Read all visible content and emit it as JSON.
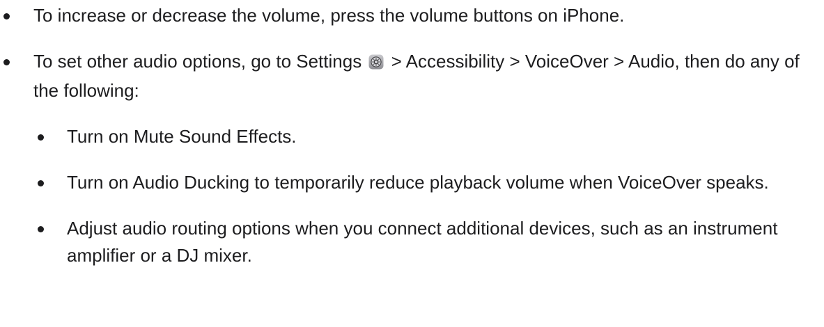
{
  "list": {
    "item1": "To increase or decrease the volume, press the volume buttons on iPhone.",
    "item2": {
      "before": "To set other audio options, go to Settings",
      "icon": "settings-gear-icon",
      "after": "> Accessibility > VoiceOver > Audio, then do any of the following:"
    },
    "subitems": [
      "Turn on Mute Sound Effects.",
      "Turn on Audio Ducking to temporarily reduce playback volume when VoiceOver speaks.",
      "Adjust audio routing options when you connect additional devices, such as an instrument amplifier or a DJ mixer."
    ]
  }
}
